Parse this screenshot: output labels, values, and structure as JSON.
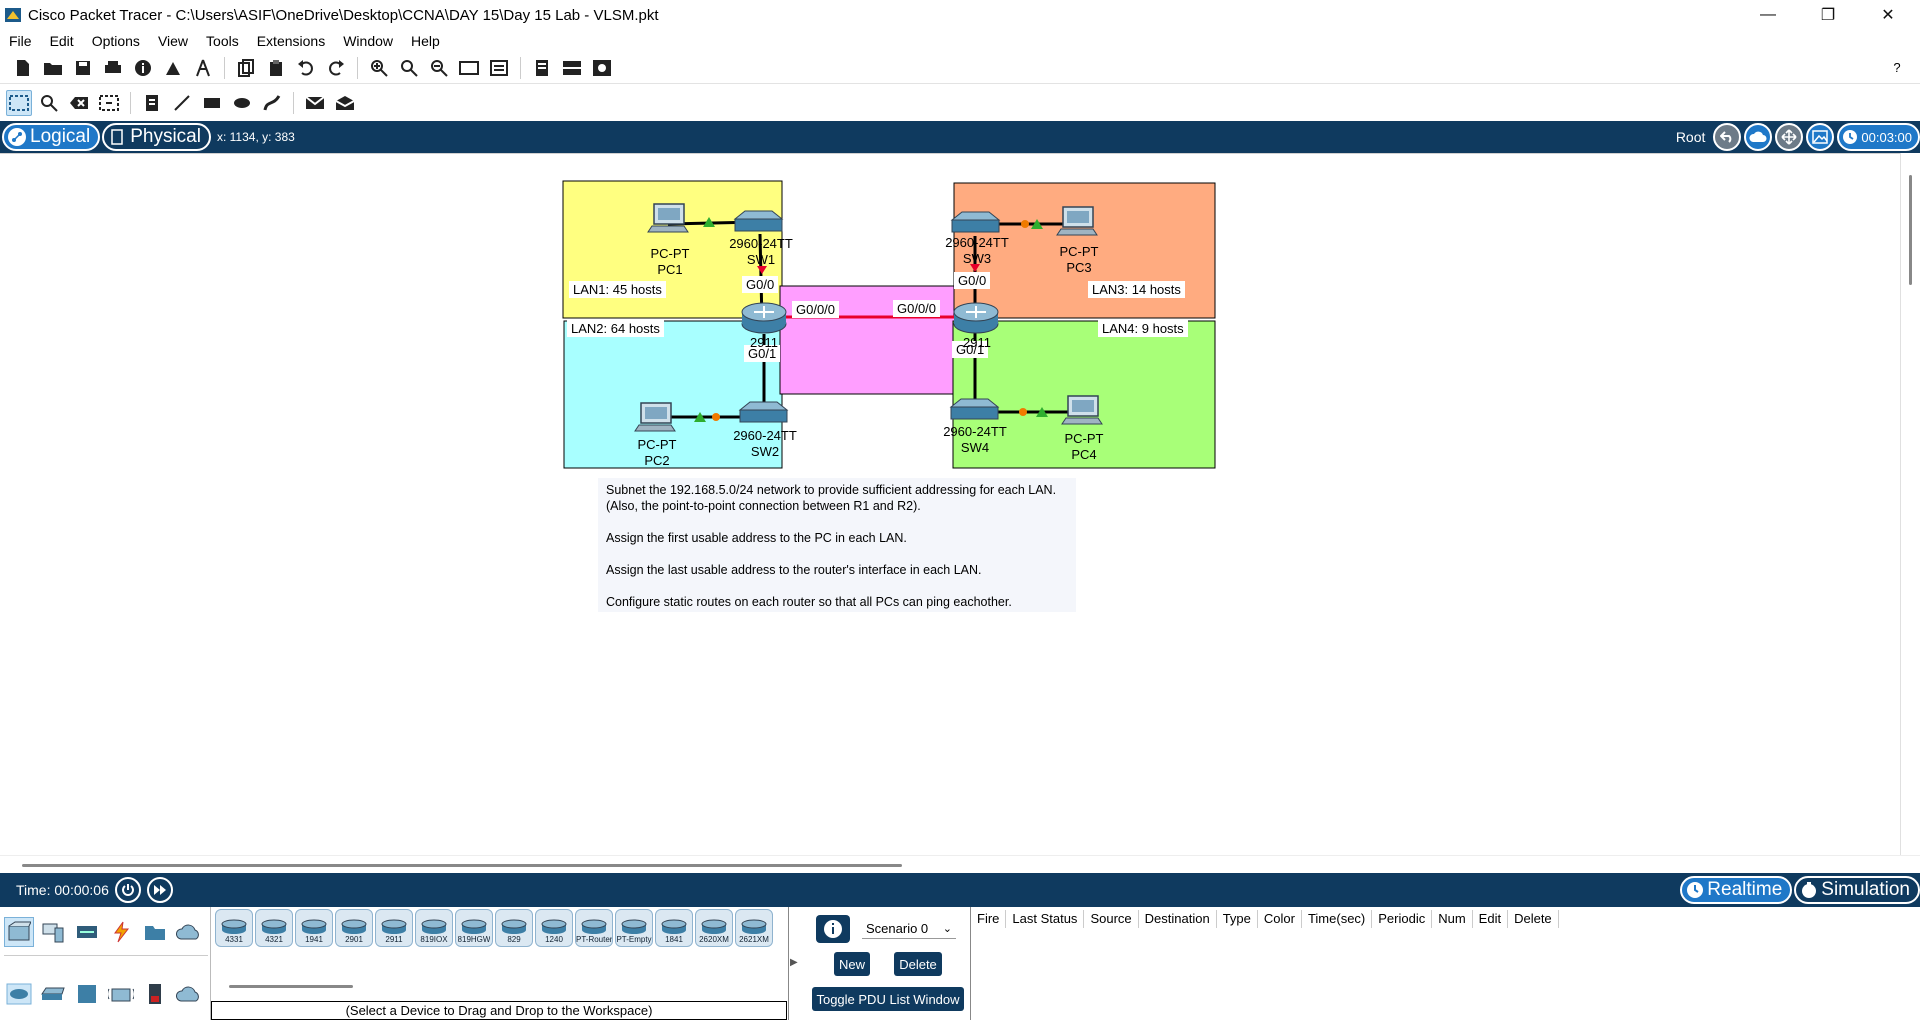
{
  "window": {
    "title": "Cisco Packet Tracer - C:\\Users\\ASIF\\OneDrive\\Desktop\\CCNA\\DAY 15\\Day 15 Lab - VLSM.pkt",
    "minimize_glyph": "—",
    "restore_glyph": "❐",
    "close_glyph": "✕"
  },
  "menu": [
    "File",
    "Edit",
    "Options",
    "View",
    "Tools",
    "Extensions",
    "Window",
    "Help"
  ],
  "help_glyph": "?",
  "modebar": {
    "logical_label": "Logical",
    "physical_label": "Physical",
    "coords": "x: 1134, y: 383",
    "root_label": "Root",
    "clock": "00:03:00"
  },
  "topology": {
    "lan_labels": {
      "lan1": "LAN1: 45 hosts",
      "lan2": "LAN2: 64 hosts",
      "lan3": "LAN3: 14 hosts",
      "lan4": "LAN4: 9 hosts"
    },
    "interfaces": {
      "r1_g00": "G0/0",
      "r1_g01": "G0/1",
      "r1_g000": "G0/0/0",
      "r2_g000": "G0/0/0",
      "r2_g00": "G0/0",
      "r2_g01": "G0/1"
    },
    "devices": {
      "pc1_model": "PC-PT",
      "pc1_name": "PC1",
      "pc2_model": "PC-PT",
      "pc2_name": "PC2",
      "pc3_model": "PC-PT",
      "pc3_name": "PC3",
      "pc4_model": "PC-PT",
      "pc4_name": "PC4",
      "sw1_model": "2960-24TT",
      "sw1_name": "SW1",
      "sw2_model": "2960-24TT",
      "sw2_name": "SW2",
      "sw3_model": "2960-24TT",
      "sw3_name": "SW3",
      "sw4_model": "2960-24TT",
      "sw4_name": "SW4",
      "r1_model": "2911",
      "r2_model": "2911"
    },
    "colors": {
      "lan1": "#ffff80",
      "lan2": "#a8ffff",
      "lan3": "#ffab80",
      "lan4": "#a8ff78",
      "wan": "#ff9eff",
      "wan_link": "#e8002a",
      "link_up": "#2fae2f",
      "link_orange": "#f07a00"
    }
  },
  "note": {
    "line1": "Subnet the 192.168.5.0/24 network to provide sufficient addressing for each LAN.",
    "line2": "(Also, the point-to-point connection between R1 and R2).",
    "line3": "Assign the first usable address to the PC in each LAN.",
    "line4": "Assign the last usable address to the router's interface in each LAN.",
    "line5": "Configure static routes on each router so that all PCs can ping eachother."
  },
  "statusbar": {
    "time": "Time: 00:00:06",
    "realtime_label": "Realtime",
    "simulation_label": "Simulation"
  },
  "device_list": [
    {
      "label": "4331"
    },
    {
      "label": "4321"
    },
    {
      "label": "1941"
    },
    {
      "label": "2901"
    },
    {
      "label": "2911"
    },
    {
      "label": "819IOX"
    },
    {
      "label": "819HGW"
    },
    {
      "label": "829"
    },
    {
      "label": "1240"
    },
    {
      "label": "PT-Router"
    },
    {
      "label": "PT-Empty"
    },
    {
      "label": "1841"
    },
    {
      "label": "2620XM"
    },
    {
      "label": "2621XM"
    }
  ],
  "device_hint": "(Select a Device to Drag and Drop to the Workspace)",
  "scenario": {
    "selected": "Scenario 0",
    "new_label": "New",
    "delete_label": "Delete",
    "toggle_label": "Toggle PDU List Window"
  },
  "pdu_columns": [
    "Fire",
    "Last Status",
    "Source",
    "Destination",
    "Type",
    "Color",
    "Time(sec)",
    "Periodic",
    "Num",
    "Edit",
    "Delete"
  ]
}
